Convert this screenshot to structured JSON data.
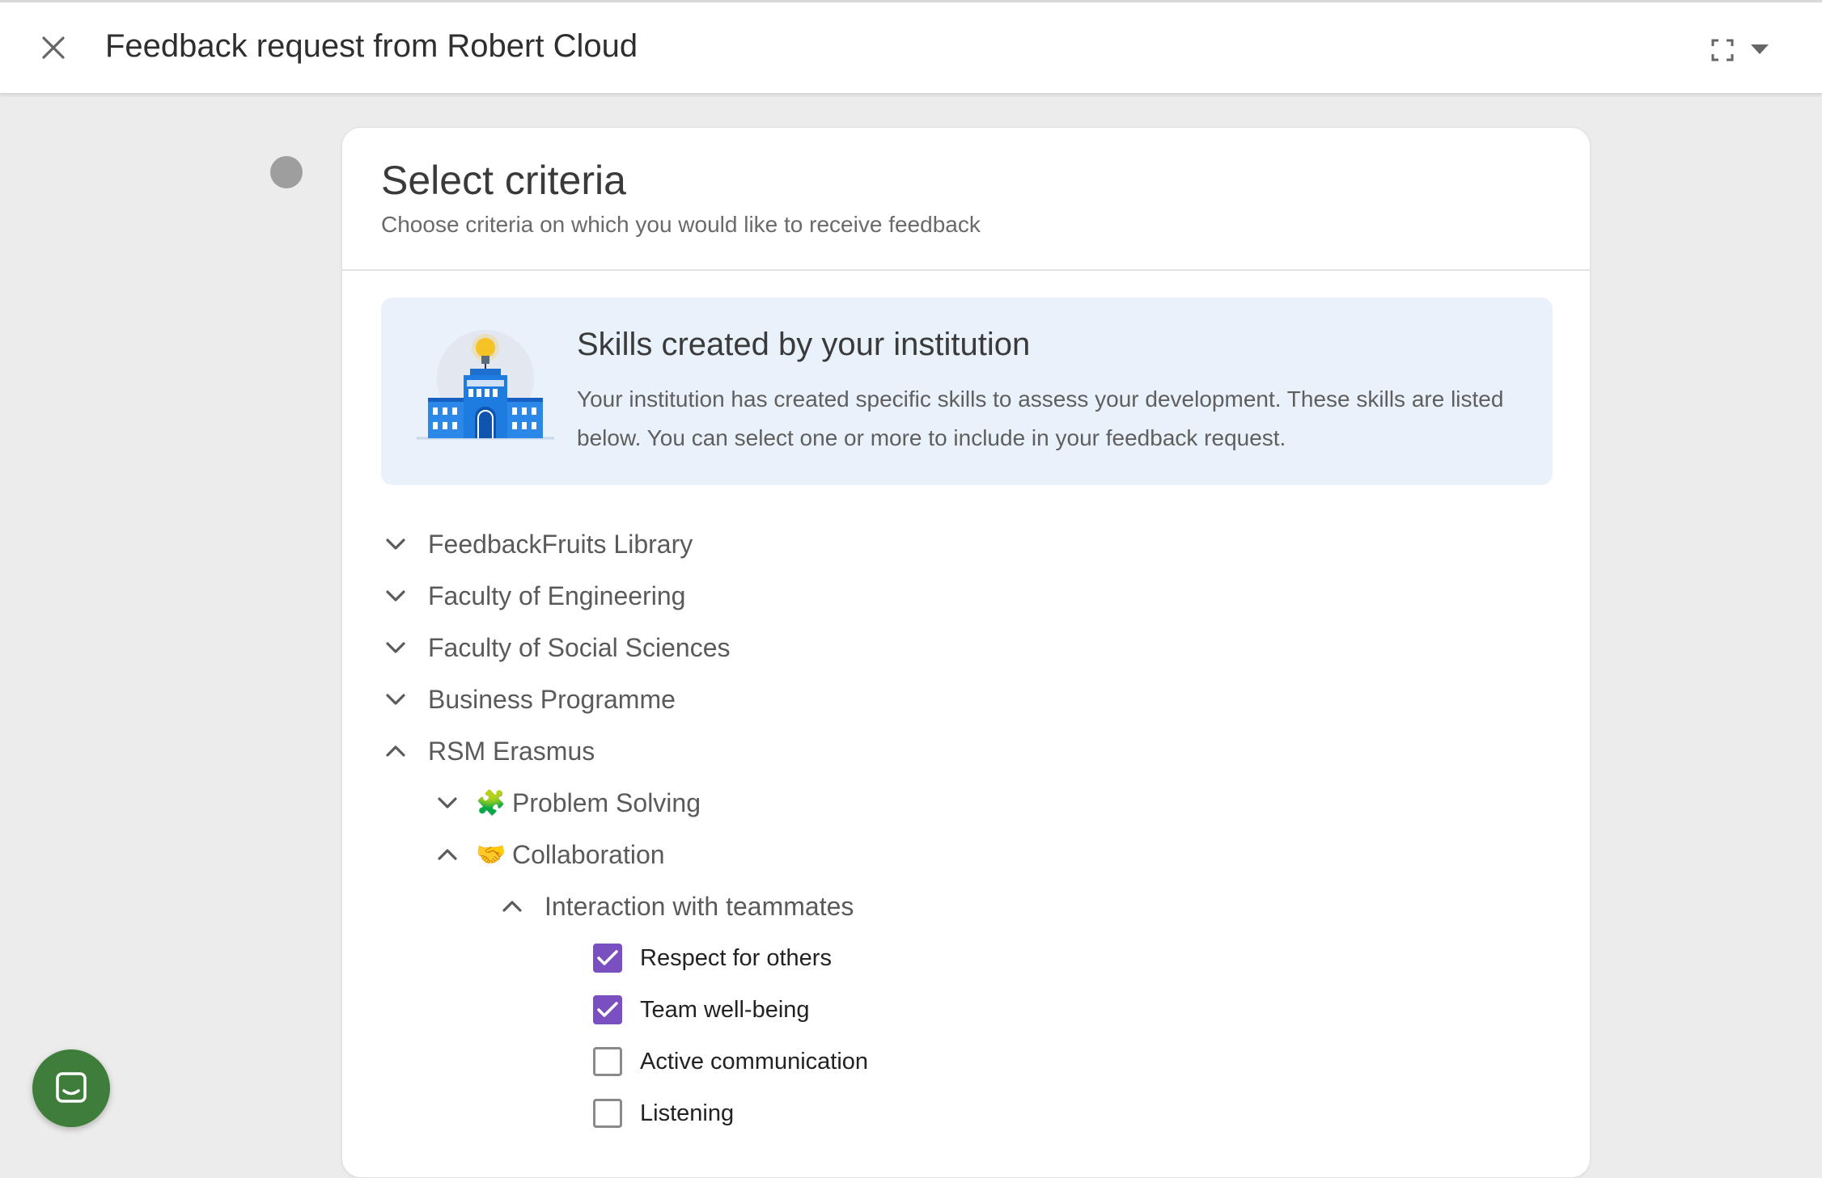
{
  "header": {
    "title": "Feedback request from Robert Cloud",
    "close_icon": "close-icon",
    "fullscreen_icon": "fullscreen-icon",
    "dropdown_icon": "caret-down-icon"
  },
  "card": {
    "title": "Select criteria",
    "subtitle": "Choose criteria on which you would like to receive feedback"
  },
  "info": {
    "title": "Skills created by your institution",
    "text": "Your institution has created specific skills to assess your development. These skills are listed below. You can select one or more to include in your feedback request.",
    "illustration": "institution-building-lightbulb"
  },
  "tree": [
    {
      "label": "FeedbackFruits Library",
      "expanded": false
    },
    {
      "label": "Faculty of Engineering",
      "expanded": false
    },
    {
      "label": "Faculty of Social Sciences",
      "expanded": false
    },
    {
      "label": "Business Programme",
      "expanded": false
    },
    {
      "label": "RSM Erasmus",
      "expanded": true
    },
    {
      "label": "Problem Solving",
      "emoji": "🧩",
      "expanded": false
    },
    {
      "label": "Collaboration",
      "emoji": "🤝",
      "expanded": true
    },
    {
      "label": "Interaction with teammates",
      "expanded": true
    }
  ],
  "criteria": [
    {
      "label": "Respect for others",
      "checked": true
    },
    {
      "label": "Team well-being",
      "checked": true
    },
    {
      "label": "Active communication",
      "checked": false
    },
    {
      "label": "Listening",
      "checked": false
    }
  ],
  "colors": {
    "checkbox_checked": "#7a4fc0",
    "chat_button": "#3f7d3a",
    "info_bg": "#e9f1fb"
  },
  "chat": {
    "icon": "chat-icon"
  }
}
